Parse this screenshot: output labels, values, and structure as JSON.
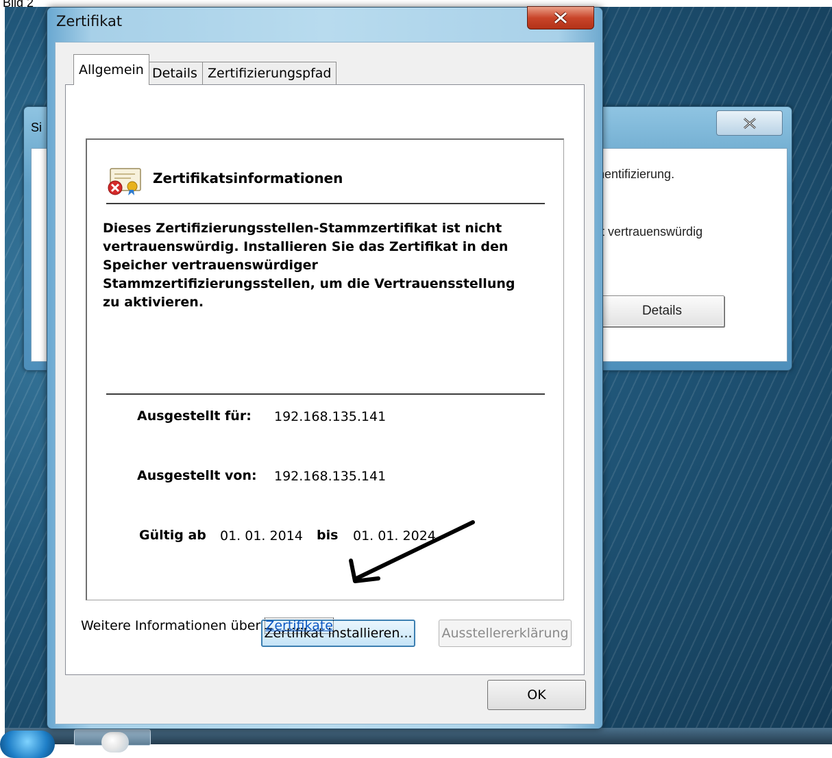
{
  "caption": "Bild 2",
  "background_window": {
    "title_fragment": "Si",
    "text_line1": "thentifizierung.",
    "text_line2": "ht vertrauenswürdig",
    "details_button": "Details"
  },
  "dialog": {
    "title": "Zertifikat",
    "tabs": [
      {
        "label": "Allgemein",
        "active": true
      },
      {
        "label": "Details",
        "active": false
      },
      {
        "label": "Zertifizierungspfad",
        "active": false
      }
    ],
    "info": {
      "heading": "Zertifikatsinformationen",
      "warning_lines": [
        "Dieses Zertifizierungsstellen-Stammzertifikat ist nicht",
        "vertrauenswürdig. Installieren Sie das Zertifikat in den",
        "Speicher vertrauenswürdiger",
        "Stammzertifizierungsstellen, um die Vertrauensstellung",
        "zu aktivieren."
      ],
      "issued_to_label": "Ausgestellt für:",
      "issued_to_value": "192.168.135.141",
      "issued_by_label": "Ausgestellt von:",
      "issued_by_value": "192.168.135.141",
      "valid_from_label": "Gültig ab",
      "valid_from_value": "01. 01. 2014",
      "valid_to_label": "bis",
      "valid_to_value": "01. 01. 2024"
    },
    "install_button": "Zertifikat installieren...",
    "issuer_statement_button": "Ausstellererklärung",
    "more_info_text": "Weitere Informationen über",
    "more_info_link": "Zertifikate",
    "ok_button": "OK"
  },
  "icons": [
    "close-icon",
    "certificate-error-icon",
    "arrow-annotation-icon"
  ]
}
